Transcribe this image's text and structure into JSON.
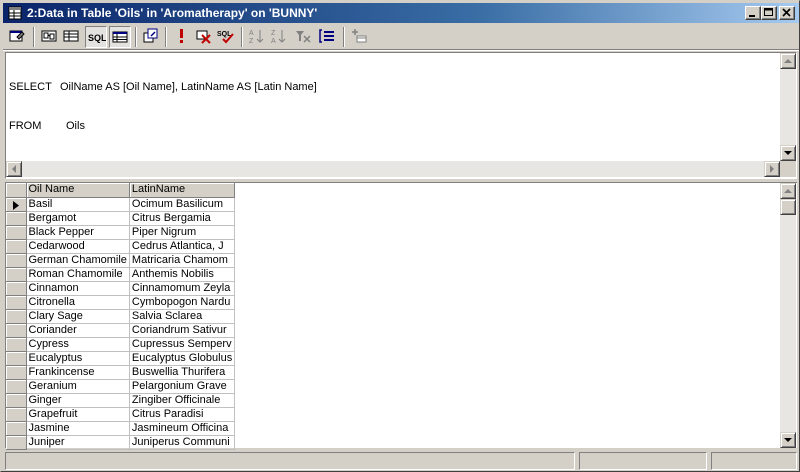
{
  "window": {
    "title": "2:Data in Table 'Oils' in 'Aromatherapy' on 'BUNNY'"
  },
  "toolbar": {
    "buttons": [
      {
        "name": "properties-icon"
      },
      {
        "name": "diagram-pane-icon"
      },
      {
        "name": "grid-pane-icon"
      },
      {
        "name": "sql-pane-icon",
        "pressed": true
      },
      {
        "name": "results-pane-icon",
        "pressed": true
      },
      {
        "name": "change-query-type-icon"
      },
      {
        "name": "run-icon"
      },
      {
        "name": "stop-icon"
      },
      {
        "name": "verify-sql-icon"
      },
      {
        "name": "sort-ascending-icon"
      },
      {
        "name": "sort-descending-icon"
      },
      {
        "name": "remove-filter-icon"
      },
      {
        "name": "group-by-icon"
      },
      {
        "name": "add-table-icon"
      }
    ]
  },
  "sql": {
    "line1_keyword": "SELECT",
    "line1_body": "OilName AS [Oil Name], LatinName AS [Latin Name]",
    "line2_keyword": "FROM",
    "line2_body": "Oils"
  },
  "grid": {
    "columns": [
      "Oil Name",
      "LatinName"
    ],
    "rows": [
      [
        "Basil",
        "Ocimum Basilicum"
      ],
      [
        "Bergamot",
        "Citrus Bergamia"
      ],
      [
        "Black Pepper",
        "Piper Nigrum"
      ],
      [
        "Cedarwood",
        "Cedrus Atlantica, J"
      ],
      [
        "German Chamomile",
        "Matricaria Chamom"
      ],
      [
        "Roman Chamomile",
        "Anthemis Nobilis"
      ],
      [
        "Cinnamon",
        "Cinnamomum Zeyla"
      ],
      [
        "Citronella",
        "Cymbopogon Nardu"
      ],
      [
        "Clary Sage",
        "Salvia Sclarea"
      ],
      [
        "Coriander",
        "Coriandrum Sativur"
      ],
      [
        "Cypress",
        "Cupressus Semperv"
      ],
      [
        "Eucalyptus",
        "Eucalyptus Globulus"
      ],
      [
        "Frankincense",
        "Buswellia Thurifera"
      ],
      [
        "Geranium",
        "Pelargonium Grave"
      ],
      [
        "Ginger",
        "Zingiber Officinale"
      ],
      [
        "Grapefruit",
        "Citrus Paradisi"
      ],
      [
        "Jasmine",
        "Jasmineum Officina"
      ],
      [
        "Juniper",
        "Juniperus Communi"
      ]
    ]
  },
  "colors": {
    "title_start": "#0a246a",
    "title_end": "#a6caf0",
    "face": "#d4d0c8"
  }
}
